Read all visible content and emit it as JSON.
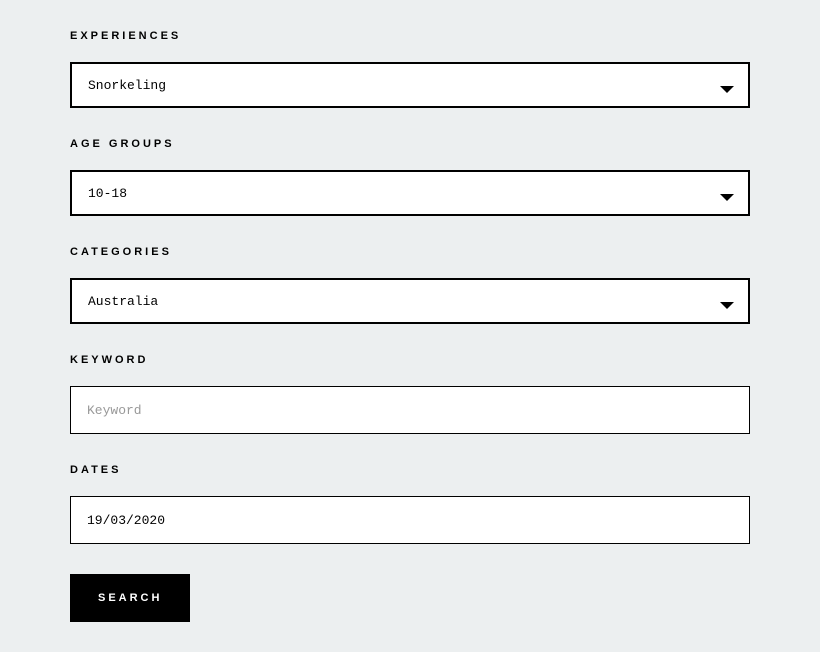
{
  "form": {
    "experiences": {
      "label": "EXPERIENCES",
      "value": "Snorkeling"
    },
    "age_groups": {
      "label": "AGE GROUPS",
      "value": "10-18"
    },
    "categories": {
      "label": "CATEGORIES",
      "value": "Australia"
    },
    "keyword": {
      "label": "KEYWORD",
      "placeholder": "Keyword",
      "value": ""
    },
    "dates": {
      "label": "DATES",
      "value": "19/03/2020"
    },
    "search_button": "SEARCH"
  }
}
